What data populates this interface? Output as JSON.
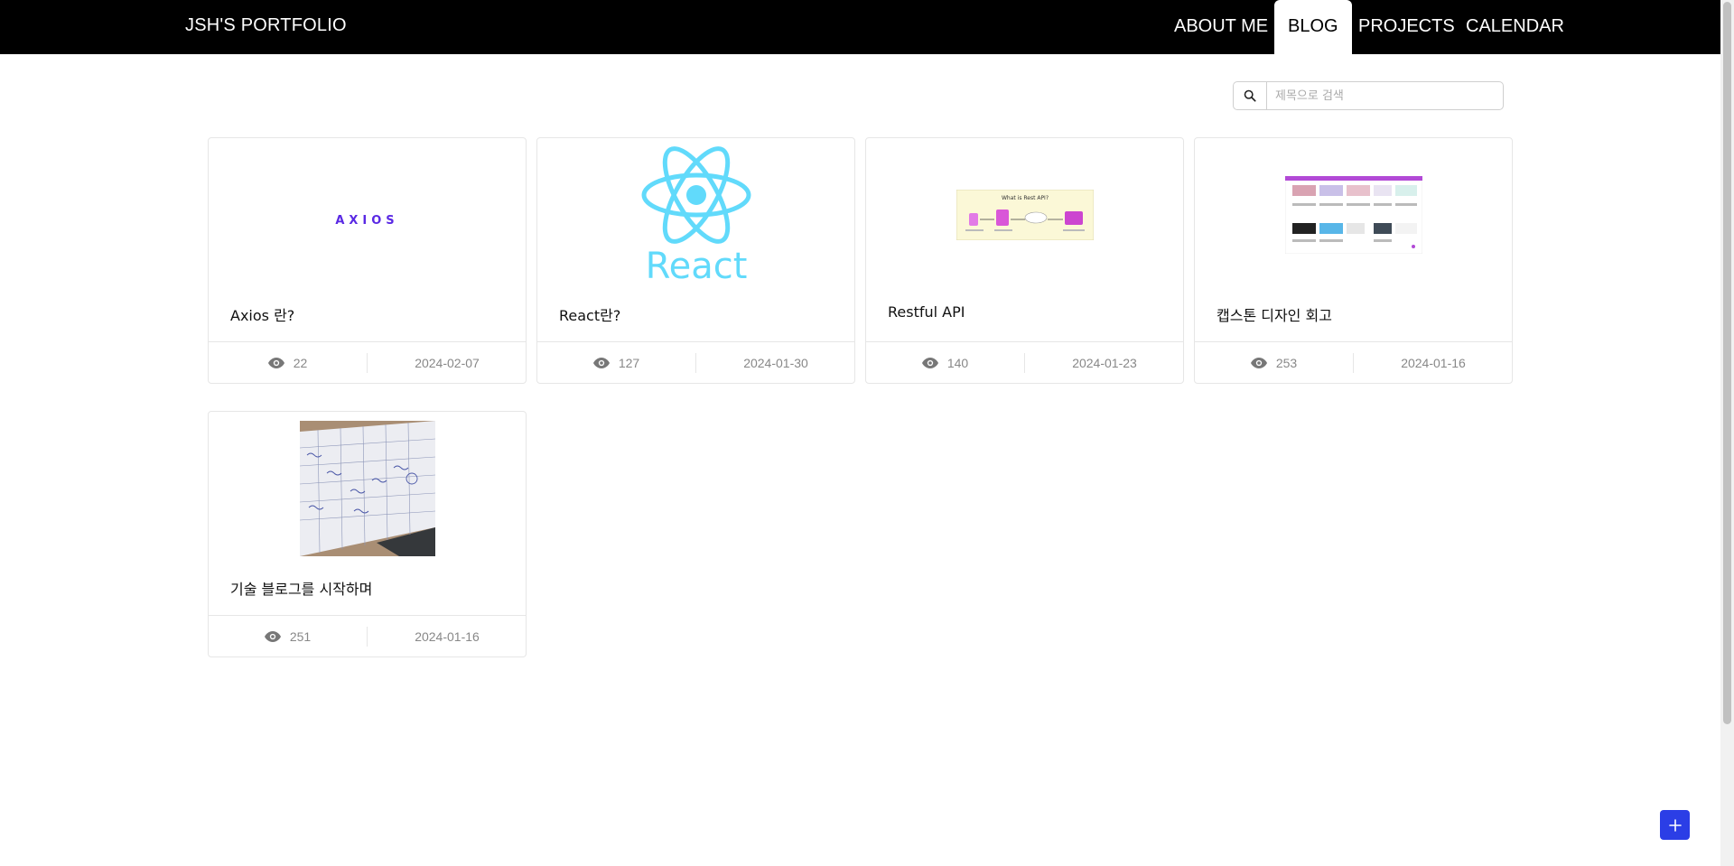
{
  "nav": {
    "brand": "JSH'S PORTFOLIO",
    "items": [
      {
        "label": "ABOUT ME",
        "active": false
      },
      {
        "label": "BLOG",
        "active": true
      },
      {
        "label": "PROJECTS",
        "active": false
      },
      {
        "label": "CALENDAR",
        "active": false
      }
    ]
  },
  "search": {
    "placeholder": "제목으로 검색",
    "icon": "search-icon"
  },
  "posts": [
    {
      "title": "Axios 란?",
      "thumbnail_text": "AXIOS",
      "views": "22",
      "date": "2024-02-07"
    },
    {
      "title": "React란?",
      "thumbnail_text": "React",
      "views": "127",
      "date": "2024-01-30"
    },
    {
      "title": "Restful API",
      "thumbnail_text": "What is Rest API?",
      "views": "140",
      "date": "2024-01-23"
    },
    {
      "title": "캡스톤 디자인 회고",
      "thumbnail_text": "",
      "views": "253",
      "date": "2024-01-16"
    },
    {
      "title": "기술 블로그를 시작하며",
      "thumbnail_text": "",
      "views": "251",
      "date": "2024-01-16"
    }
  ],
  "fab": {
    "icon": "plus-icon"
  },
  "colors": {
    "nav_bg": "#000000",
    "react": "#61dafb",
    "axios": "#5a29e4",
    "fab": "#2b3ee6"
  }
}
